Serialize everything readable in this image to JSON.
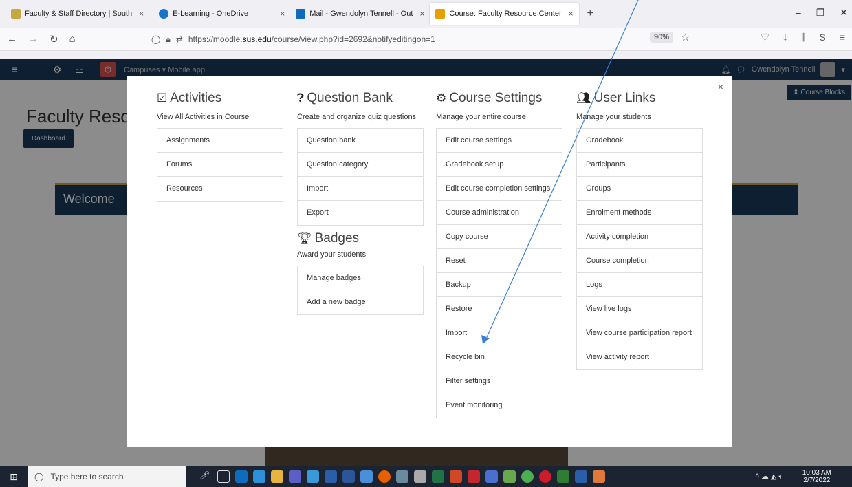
{
  "browser": {
    "tabs": [
      {
        "label": "Faculty & Staff Directory | South",
        "close": "×",
        "color": "#c8a840"
      },
      {
        "label": "E-Learning - OneDrive",
        "close": "×",
        "color": "#1a73c9"
      },
      {
        "label": "Mail - Gwendolyn Tennell - Out",
        "close": "×",
        "color": "#0f6cbd"
      },
      {
        "label": "Course: Faculty Resource Center",
        "close": "×",
        "color": "#e8a000"
      }
    ],
    "new_tab": "+",
    "url_prefix": "https://moodle.",
    "url_domain": "sus.edu",
    "url_rest": "/course/view.php?id=2692&notifyeditingon=1",
    "zoom": "90%"
  },
  "moodle_nav": {
    "links": "Campuses ▾   Mobile app",
    "user_name": "Gwendolyn Tennell"
  },
  "page": {
    "title": "Faculty Resou",
    "dashboard": "Dashboard",
    "course_blocks": "Course Blocks",
    "welcome": "Welcome"
  },
  "modal": {
    "close": "×",
    "activities": {
      "title": "Activities",
      "desc": "View All Activities in Course",
      "items": [
        "Assignments",
        "Forums",
        "Resources"
      ]
    },
    "question_bank": {
      "title": "Question Bank",
      "desc": "Create and organize quiz questions",
      "items": [
        "Question bank",
        "Question category",
        "Import",
        "Export"
      ]
    },
    "badges": {
      "title": "Badges",
      "desc": "Award your students",
      "items": [
        "Manage badges",
        "Add a new badge"
      ]
    },
    "course_settings": {
      "title": "Course Settings",
      "desc": "Manage your entire course",
      "items": [
        "Edit course settings",
        "Gradebook setup",
        "Edit course completion settings",
        "Course administration",
        "Copy course",
        "Reset",
        "Backup",
        "Restore",
        "Import",
        "Recycle bin",
        "Filter settings",
        "Event monitoring"
      ]
    },
    "user_links": {
      "title": "User Links",
      "desc": "Manage your students",
      "items": [
        "Gradebook",
        "Participants",
        "Groups",
        "Enrolment methods",
        "Activity completion",
        "Course completion",
        "Logs",
        "View live logs",
        "View course participation report",
        "View activity report"
      ]
    }
  },
  "taskbar": {
    "search_placeholder": "Type here to search",
    "time": "10:03 AM",
    "date": "2/7/2022"
  }
}
